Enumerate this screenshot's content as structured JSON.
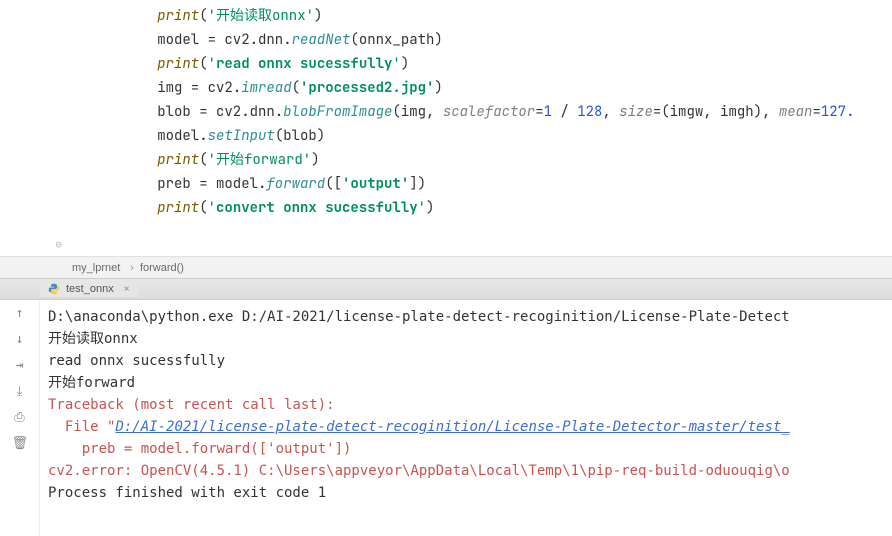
{
  "editor": {
    "indent": "        ",
    "lines": [
      {
        "tokens": [
          {
            "t": "print",
            "c": "fn"
          },
          {
            "t": "(",
            "c": "punc"
          },
          {
            "t": "'开始读取onnx'",
            "c": "str"
          },
          {
            "t": ")",
            "c": "punc"
          }
        ]
      },
      {
        "tokens": [
          {
            "t": "model = cv2.dnn.",
            "c": "id"
          },
          {
            "t": "readNet",
            "c": "fn2"
          },
          {
            "t": "(onnx_path)",
            "c": "punc"
          }
        ]
      },
      {
        "tokens": [
          {
            "t": "print",
            "c": "fn"
          },
          {
            "t": "(",
            "c": "punc"
          },
          {
            "t": "'",
            "c": "str"
          },
          {
            "t": "read onnx sucessfully",
            "c": "strb"
          },
          {
            "t": "'",
            "c": "str"
          },
          {
            "t": ")",
            "c": "punc"
          }
        ]
      },
      {
        "tokens": [
          {
            "t": "img = cv2.",
            "c": "id"
          },
          {
            "t": "imread",
            "c": "fn2"
          },
          {
            "t": "(",
            "c": "punc"
          },
          {
            "t": "'processed2.jpg'",
            "c": "strb"
          },
          {
            "t": ")",
            "c": "punc"
          }
        ]
      },
      {
        "tokens": [
          {
            "t": "blob = cv2.dnn.",
            "c": "id"
          },
          {
            "t": "blobFromImage",
            "c": "fn2"
          },
          {
            "t": "(img, ",
            "c": "punc"
          },
          {
            "t": "scalefactor",
            "c": "arg"
          },
          {
            "t": "=",
            "c": "op"
          },
          {
            "t": "1",
            "c": "num"
          },
          {
            "t": " / ",
            "c": "op"
          },
          {
            "t": "128",
            "c": "num"
          },
          {
            "t": ", ",
            "c": "punc"
          },
          {
            "t": "size",
            "c": "arg"
          },
          {
            "t": "=(imgw, imgh), ",
            "c": "punc"
          },
          {
            "t": "mean",
            "c": "arg"
          },
          {
            "t": "=",
            "c": "op"
          },
          {
            "t": "127.",
            "c": "num"
          }
        ]
      },
      {
        "tokens": [
          {
            "t": "model.",
            "c": "id"
          },
          {
            "t": "setInput",
            "c": "fn2"
          },
          {
            "t": "(blob)",
            "c": "punc"
          }
        ]
      },
      {
        "tokens": [
          {
            "t": "print",
            "c": "fn"
          },
          {
            "t": "(",
            "c": "punc"
          },
          {
            "t": "'开始forward'",
            "c": "str"
          },
          {
            "t": ")",
            "c": "punc"
          }
        ]
      },
      {
        "tokens": [
          {
            "t": "preb = model.",
            "c": "id"
          },
          {
            "t": "forward",
            "c": "fn2"
          },
          {
            "t": "([",
            "c": "punc"
          },
          {
            "t": "'output'",
            "c": "strb"
          },
          {
            "t": "])",
            "c": "punc"
          }
        ]
      },
      {
        "tokens": [
          {
            "t": "print",
            "c": "fn"
          },
          {
            "t": "(",
            "c": "punc"
          },
          {
            "t": "'",
            "c": "str"
          },
          {
            "t": "convert onnx sucessfully",
            "c": "strb"
          },
          {
            "t": "'",
            "c": "str"
          },
          {
            "t": ")",
            "c": "punc"
          }
        ]
      }
    ],
    "gutter_fold_glyph": "⊖"
  },
  "breadcrumb": {
    "items": [
      "my_lprnet",
      "forward()"
    ]
  },
  "run_tab": {
    "label": "test_onnx",
    "icon_name": "python-file-icon"
  },
  "console_toolbar": {
    "icons": [
      {
        "name": "arrow-up-icon",
        "glyph": "↑"
      },
      {
        "name": "arrow-down-icon",
        "glyph": "↓"
      },
      {
        "name": "wrap-icon",
        "glyph": "⇥"
      },
      {
        "name": "scroll-to-end-icon",
        "glyph": "⤓"
      },
      {
        "name": "print-icon",
        "glyph": "⎙"
      },
      {
        "name": "trash-icon",
        "glyph": "🗑"
      }
    ]
  },
  "console": {
    "lines": [
      {
        "c": "c-cmd",
        "t": "D:\\anaconda\\python.exe D:/AI-2021/license-plate-detect-recoginition/License-Plate-Detect"
      },
      {
        "c": "c-cmd",
        "t": "开始读取onnx"
      },
      {
        "c": "c-cmd",
        "t": "read onnx sucessfully"
      },
      {
        "c": "c-cmd",
        "t": "开始forward"
      },
      {
        "c": "c-err",
        "t": "Traceback (most recent call last):"
      },
      {
        "c": "c-err",
        "prefix": "  File \"",
        "link": "D:/AI-2021/license-plate-detect-recoginition/License-Plate-Detector-master/test_"
      },
      {
        "c": "c-err",
        "t": "    preb = model.forward(['output'])"
      },
      {
        "c": "c-err",
        "t": "cv2.error: OpenCV(4.5.1) C:\\Users\\appveyor\\AppData\\Local\\Temp\\1\\pip-req-build-oduouqig\\o"
      },
      {
        "c": "c-cmd",
        "t": ""
      },
      {
        "c": "c-cmd",
        "t": ""
      },
      {
        "c": "c-cmd",
        "t": "Process finished with exit code 1"
      }
    ]
  },
  "colors": {
    "error": "#c75450",
    "string": "#008f5a",
    "number": "#2b54d0",
    "link": "#3d6ec9"
  }
}
